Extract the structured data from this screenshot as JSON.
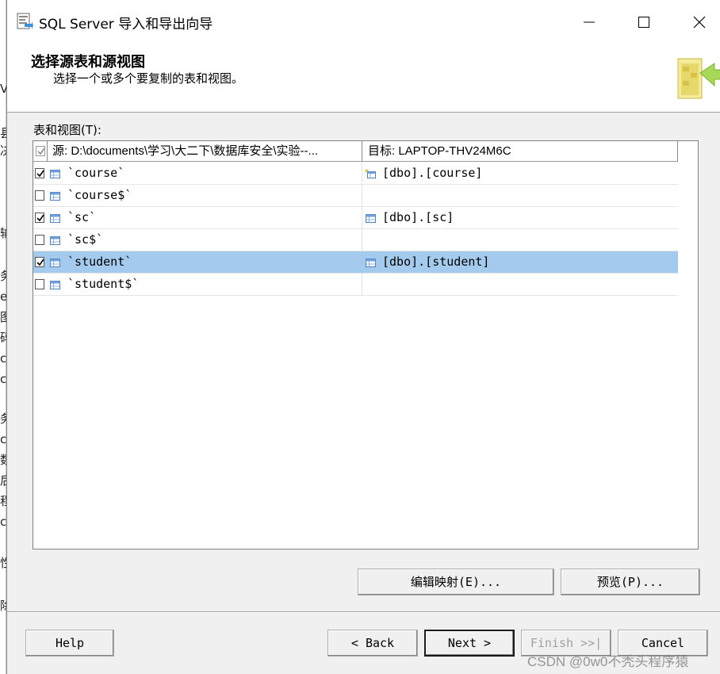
{
  "window": {
    "title": "SQL Server 导入和导出向导"
  },
  "header": {
    "title": "选择源表和源视图",
    "subtitle": "选择一个或多个要复制的表和视图。"
  },
  "tables_section": {
    "label": "表和视图(T):",
    "columns": {
      "source": "源: D:\\documents\\学习\\大二下\\数据库安全\\实验--...",
      "destination": "目标: LAPTOP-THV24M6C"
    },
    "rows": [
      {
        "checked": true,
        "source": "`course`",
        "destination": "[dbo].[course]",
        "dest_icon": "edit-table-icon",
        "selected": false
      },
      {
        "checked": false,
        "source": "`course$`",
        "destination": "",
        "dest_icon": "",
        "selected": false
      },
      {
        "checked": true,
        "source": "`sc`",
        "destination": "[dbo].[sc]",
        "dest_icon": "table-icon",
        "selected": false
      },
      {
        "checked": false,
        "source": "`sc$`",
        "destination": "",
        "dest_icon": "",
        "selected": false
      },
      {
        "checked": true,
        "source": "`student`",
        "destination": "[dbo].[student]",
        "dest_icon": "table-icon",
        "selected": true
      },
      {
        "checked": false,
        "source": "`student$`",
        "destination": "",
        "dest_icon": "",
        "selected": false
      }
    ]
  },
  "buttons": {
    "edit_mappings": "编辑映射(E)...",
    "preview": "预览(P)...",
    "help": "Help",
    "back": "< Back",
    "next": "Next >",
    "finish": "Finish >>|",
    "cancel": "Cancel"
  },
  "watermark": "CSDN @0w0不秃头程序猿",
  "colors": {
    "selection": "#a4cbee",
    "dialog_bg": "#f0f0f0"
  }
}
